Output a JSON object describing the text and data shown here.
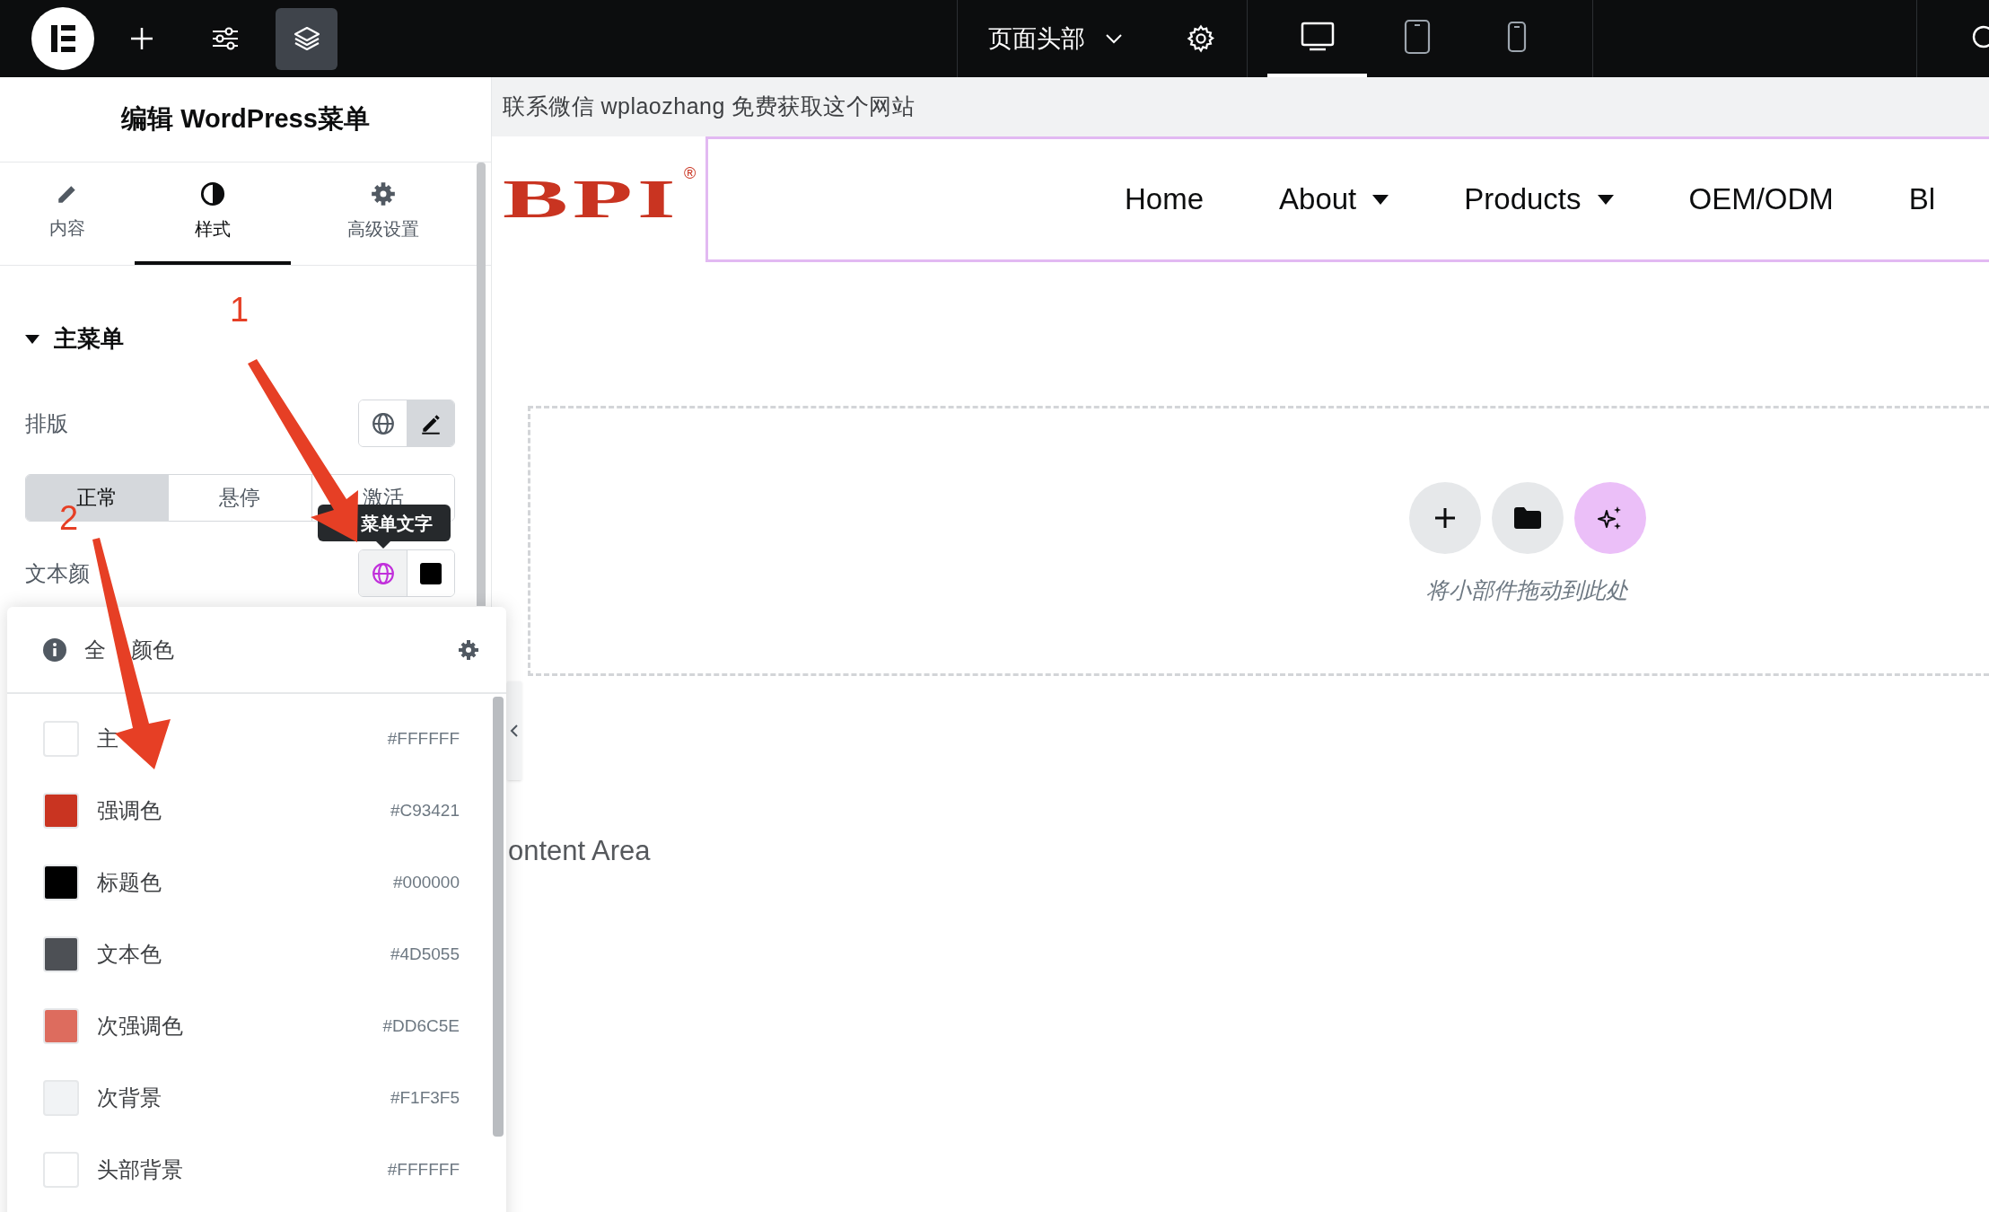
{
  "top_bar": {
    "document_title": "页面头部",
    "devices": [
      {
        "kind": "desktop",
        "selected": true
      },
      {
        "kind": "tablet",
        "selected": false
      },
      {
        "kind": "mobile",
        "selected": false
      }
    ]
  },
  "panel": {
    "title": "编辑 WordPress菜单",
    "tabs": [
      {
        "kind": "content",
        "label": "内容",
        "selected": false
      },
      {
        "kind": "style",
        "label": "样式",
        "selected": true
      },
      {
        "kind": "advanced",
        "label": "高级设置",
        "selected": false
      }
    ],
    "section": {
      "title": "主菜单",
      "expanded": true
    },
    "typography_label": "排版",
    "state_tabs": [
      {
        "label": "正常",
        "selected": true
      },
      {
        "label": "悬停",
        "selected": false
      },
      {
        "label": "激活",
        "selected": false
      }
    ],
    "tooltip": "菜单文字",
    "text_color_label": "文本颜",
    "text_color_global": true
  },
  "color_popover": {
    "title_start": "全",
    "title_end": "颜色",
    "colors": [
      {
        "name": "主",
        "hex": "#FFFFFF",
        "color": "#ffffff"
      },
      {
        "name": "强调色",
        "hex": "#C93421",
        "color": "#c93421"
      },
      {
        "name": "标题色",
        "hex": "#000000",
        "color": "#000000"
      },
      {
        "name": "文本色",
        "hex": "#4D5055",
        "color": "#4d5055"
      },
      {
        "name": "次强调色",
        "hex": "#DD6C5E",
        "color": "#dd6c5e"
      },
      {
        "name": "次背景",
        "hex": "#F1F3F5",
        "color": "#f1f3f5"
      },
      {
        "name": "头部背景",
        "hex": "#FFFFFF",
        "color": "#ffffff"
      }
    ]
  },
  "canvas": {
    "top_strip": "联系微信 wplaozhang 免费获取这个网站",
    "logo": "BPI",
    "logo_mark": "®",
    "nav": [
      {
        "label": "Home",
        "has_dropdown": false
      },
      {
        "label": "About",
        "has_dropdown": true
      },
      {
        "label": "Products",
        "has_dropdown": true
      },
      {
        "label": "OEM/ODM",
        "has_dropdown": false
      },
      {
        "label": "Bl",
        "has_dropdown": false
      }
    ],
    "drop_hint": "将小部件拖动到此处",
    "content_label": "ontent Area"
  },
  "annotations": [
    {
      "label": "1"
    },
    {
      "label": "2"
    }
  ]
}
